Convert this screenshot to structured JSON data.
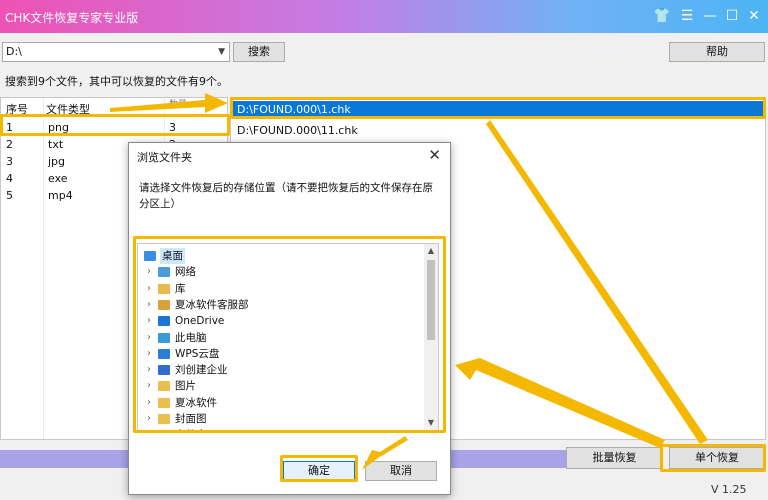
{
  "window": {
    "title": "CHK文件恢复专家专业版",
    "controls": [
      "shirt-icon",
      "menu-icon",
      "minimize-icon",
      "maximize-icon",
      "close-icon"
    ]
  },
  "toolbar": {
    "path_value": "D:\\",
    "search_label": "搜索",
    "help_label": "帮助"
  },
  "status": "搜索到9个文件，其中可以恢复的文件有9个。",
  "left_table": {
    "headers": [
      "序号",
      "文件类型",
      "数量"
    ],
    "rows": [
      {
        "index": "1",
        "type": "png",
        "count": "3"
      },
      {
        "index": "2",
        "type": "txt",
        "count": "2"
      },
      {
        "index": "3",
        "type": "jpg",
        "count": ""
      },
      {
        "index": "4",
        "type": "exe",
        "count": ""
      },
      {
        "index": "5",
        "type": "mp4",
        "count": ""
      }
    ]
  },
  "right_list": {
    "items": [
      "D:\\FOUND.000\\1.chk",
      "D:\\FOUND.000\\11.chk"
    ]
  },
  "buttons": {
    "batch_label": "批量恢复",
    "single_label": "单个恢复"
  },
  "version": "V 1.25",
  "dialog": {
    "title": "浏览文件夹",
    "description": "请选择文件恢复后的存储位置（请不要把恢复后的文件保存在原分区上）",
    "tree": [
      {
        "label": "桌面",
        "icon": "desktop-icon",
        "color": "#3b8de0",
        "expandable": false,
        "selected": true
      },
      {
        "label": "网络",
        "icon": "network-icon",
        "color": "#4a9be0",
        "expandable": true
      },
      {
        "label": "库",
        "icon": "library-icon",
        "color": "#e9b949",
        "expandable": true
      },
      {
        "label": "夏冰软件客服部",
        "icon": "user-icon",
        "color": "#d9a13a",
        "expandable": true
      },
      {
        "label": "OneDrive",
        "icon": "cloud-icon",
        "color": "#1e73d6",
        "expandable": true
      },
      {
        "label": "此电脑",
        "icon": "computer-icon",
        "color": "#3a9ad9",
        "expandable": true
      },
      {
        "label": "WPS云盘",
        "icon": "cloud-icon",
        "color": "#2a7fd4",
        "expandable": true
      },
      {
        "label": "刘创建企业",
        "icon": "building-icon",
        "color": "#2f6fc9",
        "expandable": true
      },
      {
        "label": "图片",
        "icon": "folder-icon",
        "color": "#e9c04d",
        "expandable": true
      },
      {
        "label": "夏冰软件",
        "icon": "folder-icon",
        "color": "#e9c04d",
        "expandable": true
      },
      {
        "label": "封面图",
        "icon": "folder-icon",
        "color": "#e9c04d",
        "expandable": true
      },
      {
        "label": "文件夹",
        "icon": "folder-icon",
        "color": "#e9c04d",
        "expandable": true
      }
    ],
    "ok_label": "确定",
    "cancel_label": "取消"
  },
  "colors": {
    "highlight": "#f5b800",
    "selection": "#0a78d7"
  }
}
